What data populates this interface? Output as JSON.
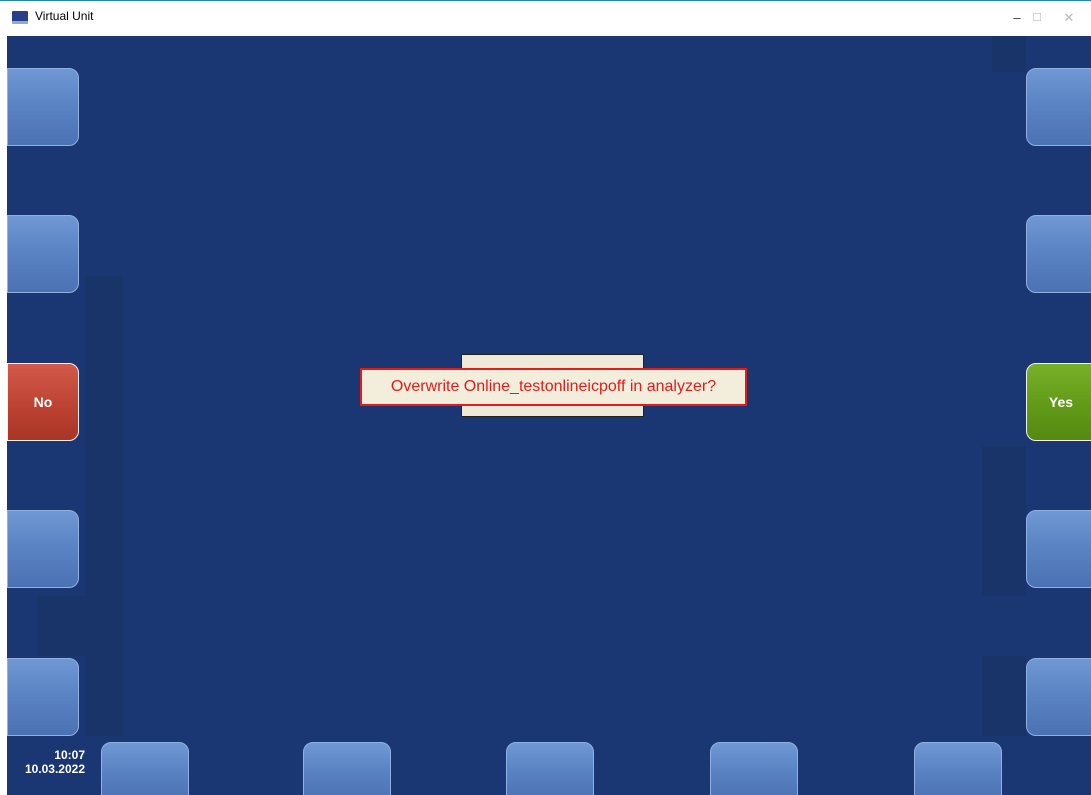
{
  "window": {
    "title": "Virtual Unit",
    "minimize_glyph": "–",
    "maximize_glyph": "☐",
    "close_glyph": "✕"
  },
  "softkeys": {
    "left_3_label": "No",
    "right_3_label": "Yes"
  },
  "dialog": {
    "message": "Overwrite Online_testonlineicpoff in analyzer?"
  },
  "clock": {
    "time": "10:07",
    "date": "10.03.2022"
  },
  "colors": {
    "background": "#1a3773",
    "no_button": "#bd4333",
    "yes_button": "#629a18",
    "message_text": "#e41b1b"
  }
}
